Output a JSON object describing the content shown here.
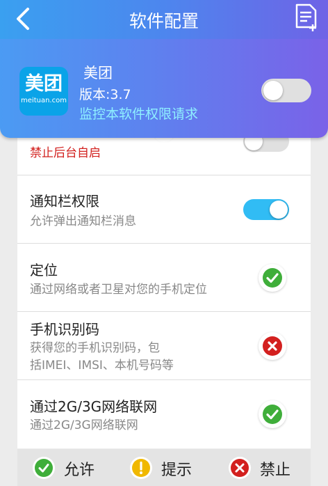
{
  "header": {
    "title": "软件配置"
  },
  "app": {
    "icon_text": "美团",
    "icon_subtext": "meituan.com",
    "name": "美团",
    "version": "版本:3.7",
    "monitor_text": "监控本软件权限请求",
    "monitor_enabled": false
  },
  "permissions": [
    {
      "title": "",
      "desc": "禁止后台自启",
      "control": "toggle",
      "on": false
    },
    {
      "title": "通知栏权限",
      "desc": "允许弹出通知栏消息",
      "control": "toggle",
      "on": true
    },
    {
      "title": "定位",
      "desc": "通过网络或者卫星对您的手机定位",
      "control": "status",
      "status": "allow"
    },
    {
      "title": "手机识别码",
      "desc_line1": "获得您的手机识别码，包",
      "desc_line2": "括IMEI、IMSI、本机号码等",
      "control": "status",
      "status": "deny"
    },
    {
      "title": "通过2G/3G网络联网",
      "desc": "通过2G/3G网络联网",
      "control": "status",
      "status": "allow"
    }
  ],
  "legend": {
    "allow": "允许",
    "prompt": "提示",
    "deny": "禁止"
  },
  "colors": {
    "allow": "#3fae3a",
    "prompt": "#f0b800",
    "deny": "#d3201f",
    "toggle_on": "#31bcf4",
    "toggle_off": "#e0e0e0"
  }
}
